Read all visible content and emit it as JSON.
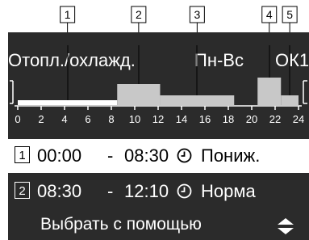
{
  "callouts": [
    "1",
    "2",
    "3",
    "4",
    "5"
  ],
  "header": {
    "mode": "Отопл./охлажд.",
    "days": "Пн-Вс",
    "status": "ОК1"
  },
  "chart_data": {
    "type": "step",
    "x_ticks": [
      "0",
      "2",
      "4",
      "6",
      "8",
      "10",
      "12",
      "14",
      "16",
      "18",
      "20",
      "22",
      "24"
    ],
    "xlim": [
      0,
      24
    ],
    "segments": [
      {
        "index": "1",
        "start": 0,
        "end": 8.5,
        "level": 1
      },
      {
        "index": "2",
        "start": 8.5,
        "end": 12.17,
        "level": 3
      },
      {
        "index": "3",
        "start": 12.17,
        "end": 18.5,
        "level": 2
      },
      {
        "index": "4",
        "start": 20.5,
        "end": 22.5,
        "level": 4
      },
      {
        "index": "5",
        "start": 22.5,
        "end": 24,
        "level": 2
      }
    ],
    "colors": {
      "active": "#ffffff",
      "inactive": "#c8c8c8"
    }
  },
  "rows": [
    {
      "index": "1",
      "start": "00:00",
      "dash": "-",
      "end": "08:30",
      "clock_icon": "clock-icon",
      "mode": "Пониж."
    },
    {
      "index": "2",
      "start": "08:30",
      "dash": "-",
      "end": "12:10",
      "clock_icon": "clock-icon",
      "mode": "Норма"
    }
  ],
  "footer": {
    "label": "Выбрать с помощью",
    "icon": "up-down-arrows-icon"
  }
}
